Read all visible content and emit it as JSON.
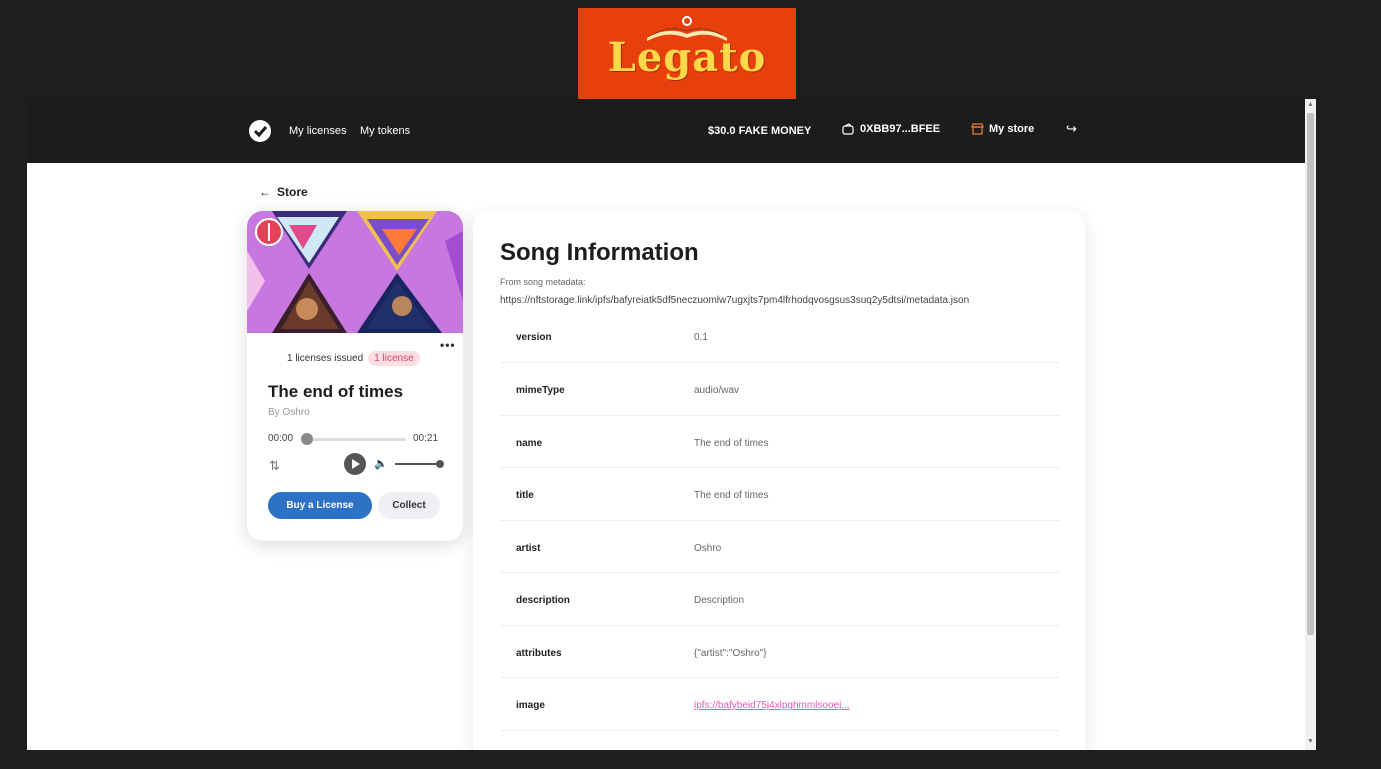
{
  "logo": {
    "word": "Legato"
  },
  "navbar": {
    "links": [
      "My licenses",
      "My tokens"
    ],
    "money": "$30.0 FAKE MONEY",
    "wallet": "0XBB97...BFEE",
    "my_store": "My store"
  },
  "back": {
    "label": "Store"
  },
  "card": {
    "licenses_issued": "1 licenses issued",
    "badge": "1 license",
    "title": "The end of times",
    "artist": "By Oshro",
    "time_current": "00:00",
    "time_total": "00:21",
    "progress": 0,
    "volume": 1,
    "buy_label": "Buy a License",
    "collect_label": "Collect"
  },
  "info": {
    "heading": "Song Information",
    "from_label": "From song metadata:",
    "url": "https://nftstorage.link/ipfs/bafyreiatk5df5neczuomlw7ugxjts7pm4lfrhodqvosgsus3suq2y5dtsi/metadata.json",
    "rows": [
      {
        "key": "version",
        "value": "0.1"
      },
      {
        "key": "mimeType",
        "value": "audio/wav"
      },
      {
        "key": "name",
        "value": "The end of times"
      },
      {
        "key": "title",
        "value": "The end of times"
      },
      {
        "key": "artist",
        "value": "Oshro"
      },
      {
        "key": "description",
        "value": "Description"
      },
      {
        "key": "attributes",
        "value": "{\"artist\":\"Oshro\"}"
      },
      {
        "key": "image",
        "value": "ipfs://bafybeid75j4xlpghmmlsooej..."
      }
    ]
  },
  "colors": {
    "accent": "#2d72c4",
    "logo_bg": "#e8400c",
    "badge_bg": "#fbdde3",
    "link": "#e45ab8"
  }
}
